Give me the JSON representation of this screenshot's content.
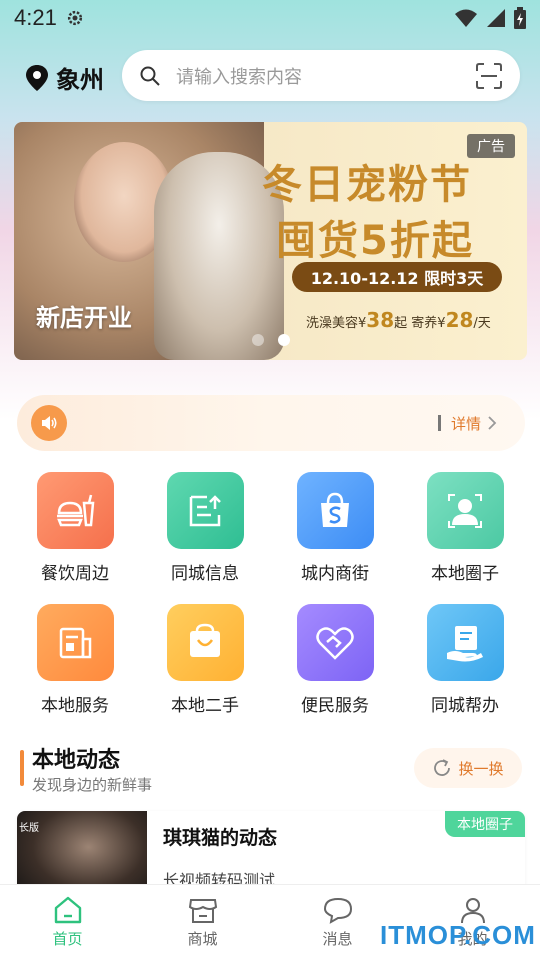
{
  "status_bar": {
    "time": "4:21"
  },
  "header": {
    "location": "象州",
    "search_placeholder": "请输入搜索内容"
  },
  "banner": {
    "ad_tag": "广告",
    "headline_1": "冬日宠粉节",
    "headline_2": "囤货5折起",
    "date_text": "12.10-12.12 限时3天",
    "price_line": {
      "bath_label": "洗澡美容¥",
      "bath_price": "38",
      "bath_suffix": "起",
      "board_label": "寄养¥",
      "board_price": "28",
      "board_suffix": "/天"
    },
    "title": "新店开业",
    "page_count": 2,
    "active_page": 2
  },
  "notice": {
    "details_label": "详情"
  },
  "grid": {
    "items": [
      {
        "label": "餐饮周边",
        "icon": "food-icon",
        "color_from": "#ff9a73",
        "color_to": "#f5704c"
      },
      {
        "label": "同城信息",
        "icon": "upload-doc-icon",
        "color_from": "#5fd8b0",
        "color_to": "#2fbe93"
      },
      {
        "label": "城内商街",
        "icon": "shopping-bag-icon",
        "color_from": "#6fb3ff",
        "color_to": "#3d8df5"
      },
      {
        "label": "本地圈子",
        "icon": "user-circle-icon",
        "color_from": "#7de0c2",
        "color_to": "#4cc9a3"
      },
      {
        "label": "本地服务",
        "icon": "service-doc-icon",
        "color_from": "#ffab5e",
        "color_to": "#ff8a3d"
      },
      {
        "label": "本地二手",
        "icon": "basket-icon",
        "color_from": "#ffce5e",
        "color_to": "#ffb133"
      },
      {
        "label": "便民服务",
        "icon": "heart-handshake-icon",
        "color_from": "#a58bff",
        "color_to": "#7d64f5"
      },
      {
        "label": "同城帮办",
        "icon": "hand-doc-icon",
        "color_from": "#6fc7f7",
        "color_to": "#3aa7ea"
      }
    ]
  },
  "section": {
    "title": "本地动态",
    "subtitle": "发现身边的新鲜事",
    "refresh_label": "换一换"
  },
  "feed": [
    {
      "thumb_tag": "长版",
      "title": "琪琪猫的动态",
      "desc": "长视频转码测试",
      "tag": "本地圈子"
    }
  ],
  "bottom_nav": {
    "items": [
      {
        "label": "首页",
        "icon": "home-icon",
        "active": true
      },
      {
        "label": "商城",
        "icon": "store-icon",
        "active": false
      },
      {
        "label": "消息",
        "icon": "chat-icon",
        "active": false
      },
      {
        "label": "我的",
        "icon": "user-icon",
        "active": false
      }
    ]
  },
  "watermark": "ITMOP.COM",
  "colors": {
    "accent": "#2ec27e",
    "orange": "#f28a3a"
  }
}
